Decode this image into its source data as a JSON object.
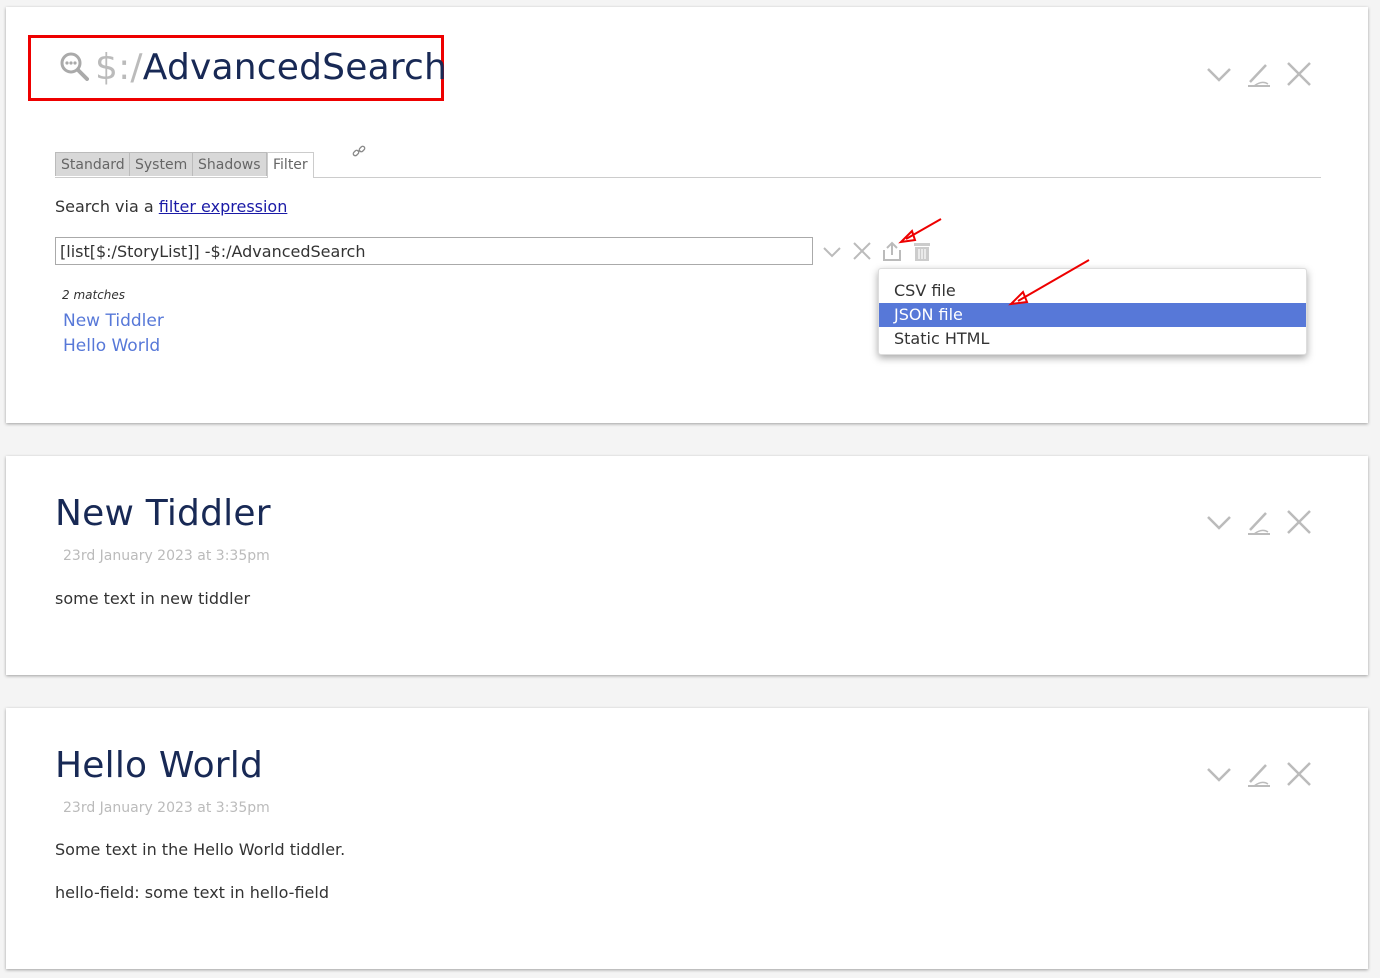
{
  "advanced_search": {
    "title_prefix": "$:/",
    "title_main": "AdvancedSearch",
    "tabs": [
      "Standard",
      "System",
      "Shadows",
      "Filter"
    ],
    "intro_text": "Search via a ",
    "intro_link": "filter expression",
    "filter_value": "[list[$:/StoryList]] -$:/AdvancedSearch",
    "matches_label": "2 matches",
    "results": [
      "New Tiddler",
      "Hello World"
    ],
    "export_menu": [
      "CSV file",
      "JSON file",
      "Static HTML"
    ],
    "selected_export": "JSON file"
  },
  "tiddlers": [
    {
      "title": "New Tiddler",
      "modified": "23rd January 2023 at 3:35pm",
      "text": "some text in new tiddler"
    },
    {
      "title": "Hello World",
      "modified": "23rd January 2023 at 3:35pm",
      "text": "Some text in the Hello World tiddler.",
      "field_line": "hello-field: some text in hello-field"
    }
  ],
  "colors": {
    "title": "#182955",
    "link": "#5778d8",
    "highlight": "#5778d8",
    "annotation": "#ee0000"
  }
}
